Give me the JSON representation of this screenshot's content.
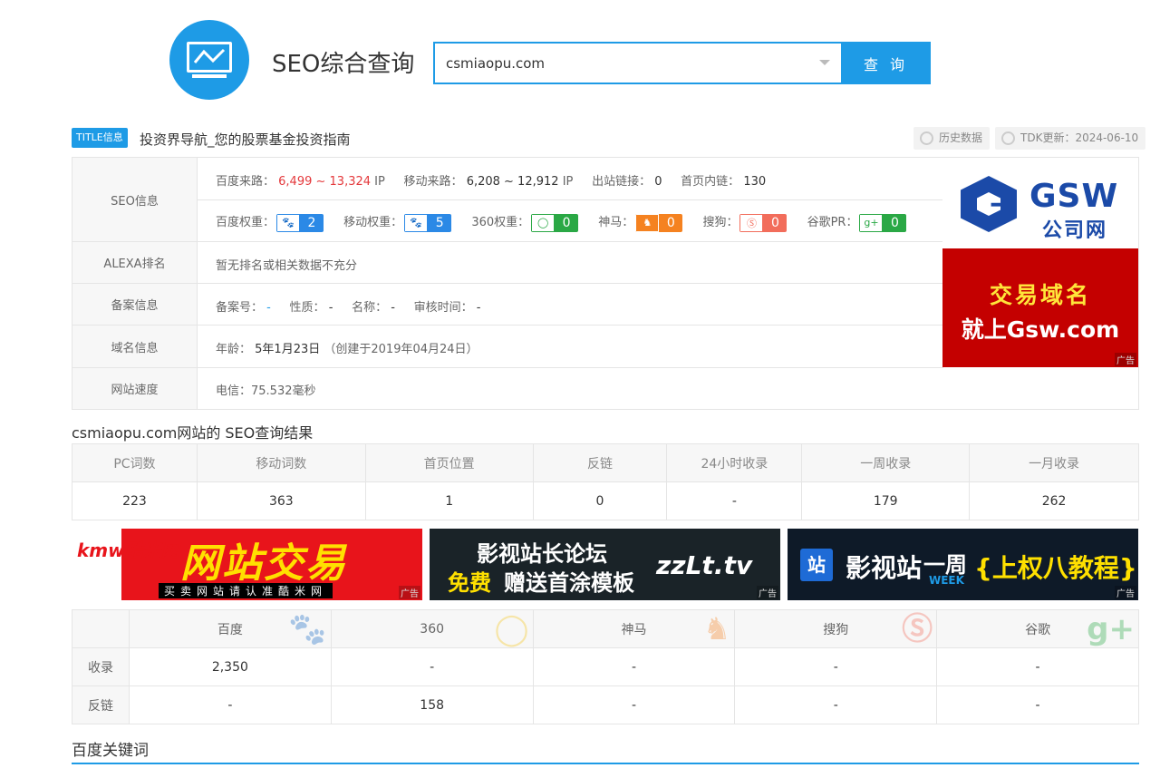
{
  "header": {
    "site_title": "SEO综合查询",
    "search_value": "csmiaopu.com",
    "search_button": "查 询"
  },
  "title_row": {
    "tag": "TITLE信息",
    "title": "投资界导航_您的股票基金投资指南",
    "history_label": "历史数据",
    "tdk_label": "TDK更新：2024-06-10"
  },
  "seo_info": {
    "label": "SEO信息",
    "baidu_traffic_label": "百度来路：",
    "baidu_traffic_value": "6,499 ~ 13,324",
    "baidu_traffic_unit": "IP",
    "mobile_traffic_label": "移动来路：",
    "mobile_traffic_value": "6,208 ~ 12,912",
    "mobile_traffic_unit": "IP",
    "outbound_label": "出站链接：",
    "outbound_value": "0",
    "inner_label": "首页内链：",
    "inner_value": "130",
    "weights": [
      {
        "label": "百度权重：",
        "icon": "paw-icon",
        "value": "2",
        "color": "#2b89e6"
      },
      {
        "label": "移动权重：",
        "icon": "paw-icon",
        "value": "5",
        "color": "#2b89e6"
      },
      {
        "label": "360权重：",
        "icon": "circle-icon",
        "value": "0",
        "color": "#2aa845"
      },
      {
        "label": "神马：",
        "icon": "horse-icon",
        "value": "0",
        "color": "#f58220"
      },
      {
        "label": "搜狗：",
        "icon": "sogou-icon",
        "value": "0",
        "color": "#f26d5b"
      },
      {
        "label": "谷歌PR：",
        "icon": "gplus-icon",
        "value": "0",
        "color": "#2aa845"
      }
    ]
  },
  "alexa": {
    "label": "ALEXA排名",
    "value": "暂无排名或相关数据不充分"
  },
  "beian": {
    "label": "备案信息",
    "num_label": "备案号：",
    "num_value": "-",
    "type_label": "性质：",
    "type_value": "-",
    "name_label": "名称：",
    "name_value": "-",
    "time_label": "审核时间：",
    "time_value": "-"
  },
  "domain": {
    "label": "域名信息",
    "age_label": "年龄：",
    "age_value": "5年1月23日",
    "created": "（创建于2019年04月24日）"
  },
  "speed": {
    "label": "网站速度",
    "value": "电信：75.532毫秒"
  },
  "ad_right": {
    "brand": "GSW",
    "brand_cn": "公司网",
    "line1": "交易域名",
    "line2": "就上Gsw.com",
    "tag": "广告"
  },
  "result_title": "csmiaopu.com网站的 SEO查询结果",
  "stats": {
    "headers": [
      "PC词数",
      "移动词数",
      "首页位置",
      "反链",
      "24小时收录",
      "一周收录",
      "一月收录"
    ],
    "values": [
      "223",
      "363",
      "1",
      "0",
      "-",
      "179",
      "262"
    ]
  },
  "banners": [
    {
      "logo": "kmw酷米网",
      "big": "网站交易",
      "small": "买卖网站请认准酷米网",
      "tag": "广告"
    },
    {
      "line1": "影视站长论坛",
      "free": "免费",
      "line2": "赠送首涂模板",
      "brand": "zzLt.tv",
      "tag": "广告"
    },
    {
      "box": "站",
      "t1": "影视站",
      "t2": "一周",
      "week": "WEEK",
      "t3": "{上权八教程}",
      "tag": "广告"
    }
  ],
  "engines": {
    "headers": [
      "百度",
      "360",
      "神马",
      "搜狗",
      "谷歌"
    ],
    "icons": [
      "paw-icon",
      "search-icon",
      "horse-icon",
      "sogou-icon",
      "gplus-icon"
    ],
    "rows": [
      {
        "label": "收录",
        "values": [
          "2,350",
          "-",
          "-",
          "-",
          "-"
        ]
      },
      {
        "label": "反链",
        "values": [
          "-",
          "158",
          "-",
          "-",
          "-"
        ]
      }
    ]
  },
  "keyword_title": "百度关键词"
}
